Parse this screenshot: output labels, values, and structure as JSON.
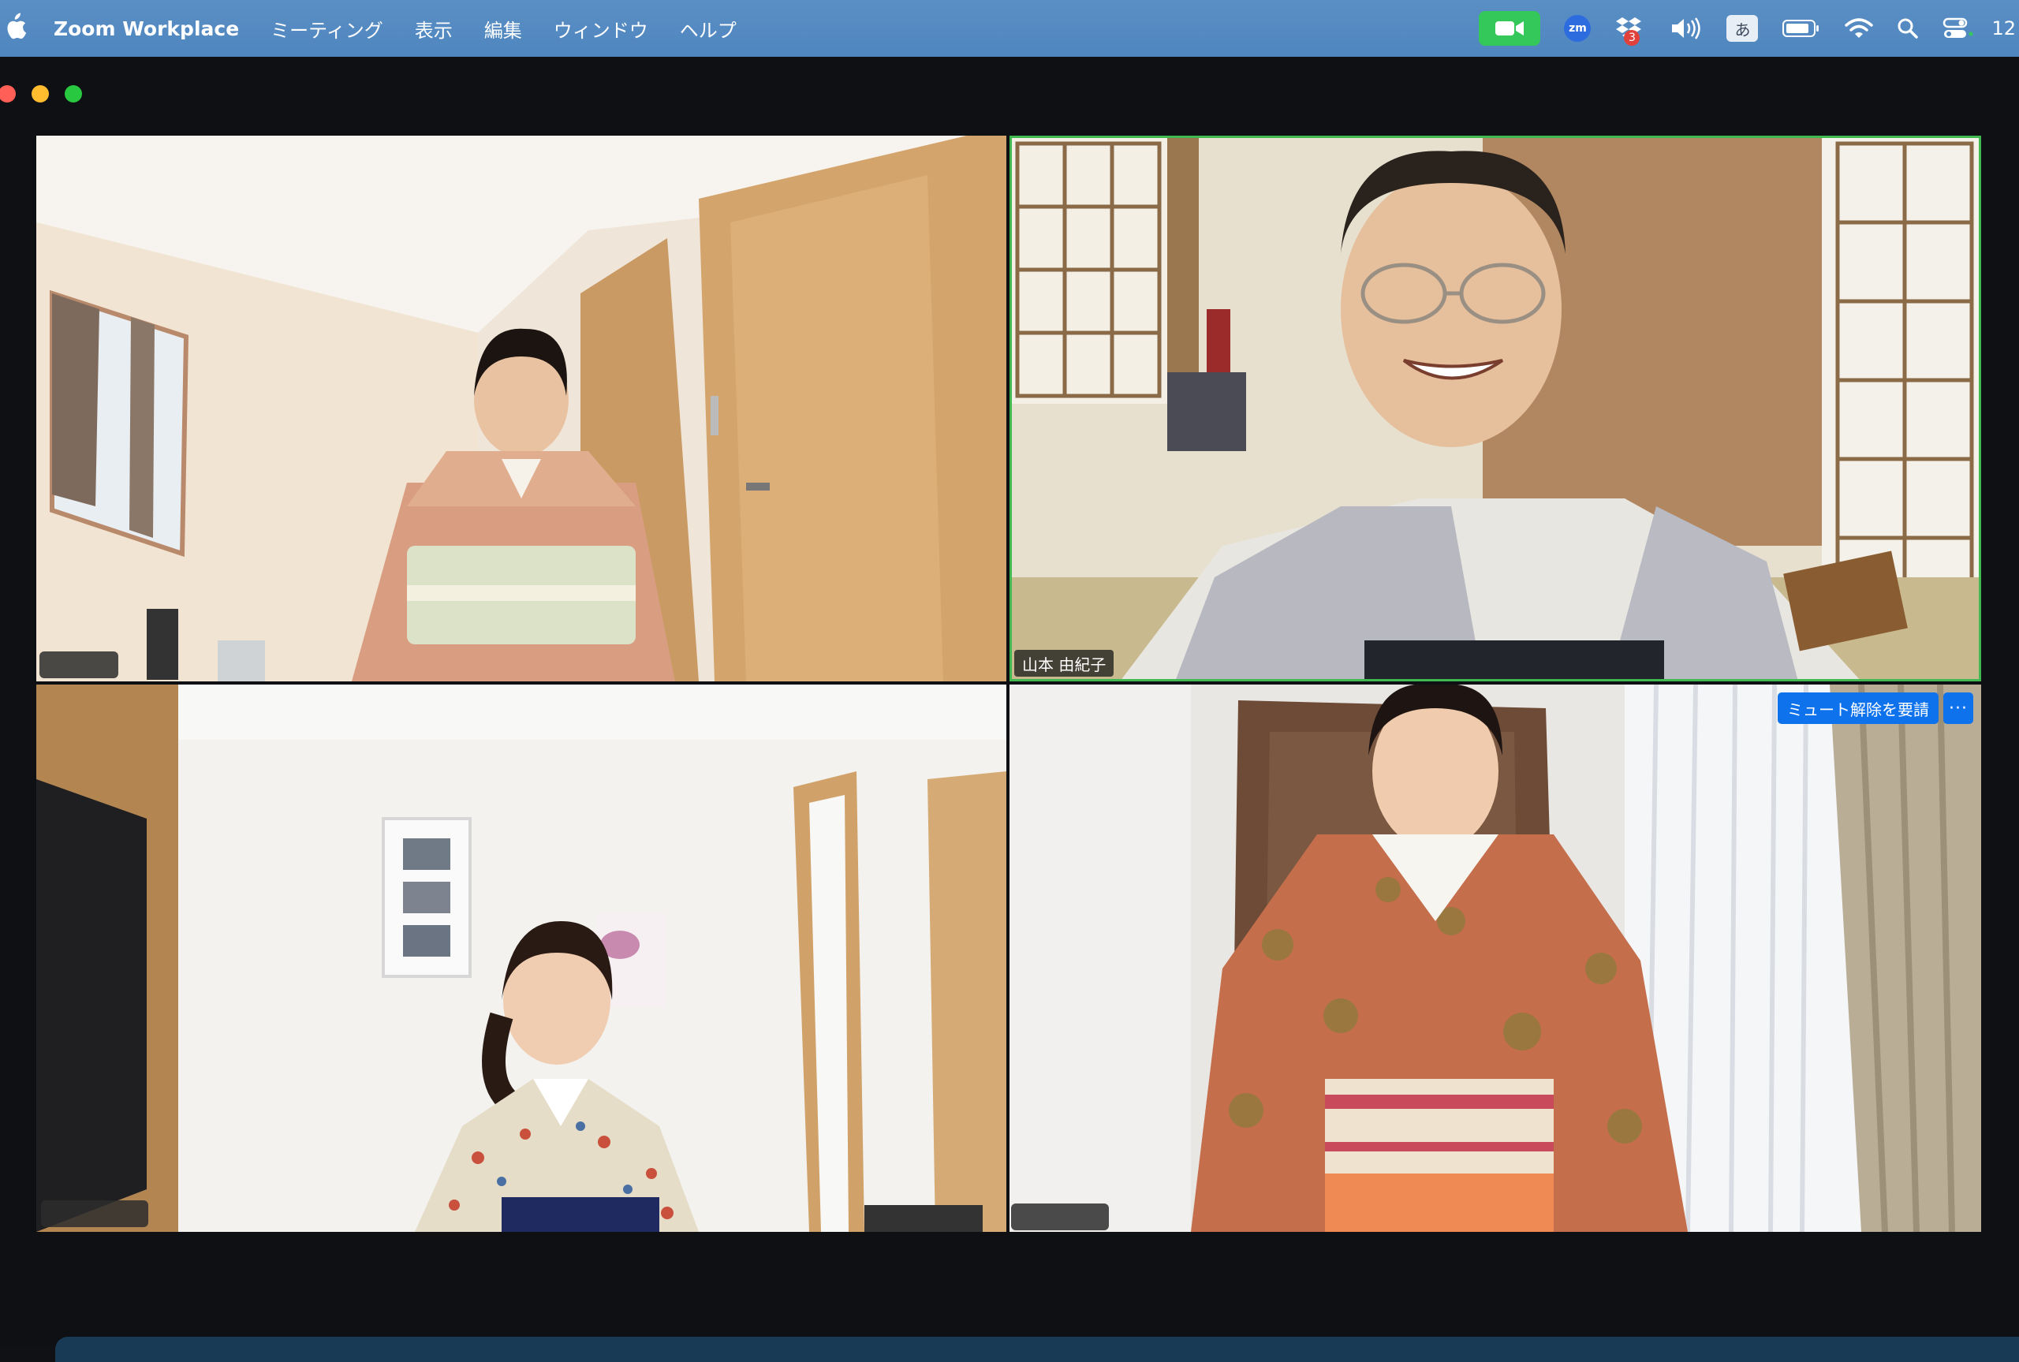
{
  "menubar": {
    "app_name": "Zoom Workplace",
    "menus": [
      "ミーティング",
      "表示",
      "編集",
      "ウィンドウ",
      "ヘルプ"
    ],
    "status_icons": [
      "zoom-video-icon",
      "zoom-app-icon",
      "dropbox-icon",
      "volume-icon",
      "input-method-icon",
      "battery-icon",
      "wifi-icon",
      "spotlight-search-icon",
      "control-center-icon"
    ],
    "zm_label": "zm",
    "dropbox_badge": "3",
    "ime_label": "あ",
    "clock": "12"
  },
  "meeting": {
    "tiles": [
      {
        "name": ""
      },
      {
        "name": "山本 由紀子",
        "active_speaker": true
      },
      {
        "name": ""
      },
      {
        "name": "",
        "ask_unmute_label": "ミュート解除を要請",
        "more_label": "···"
      }
    ]
  },
  "colors": {
    "menubar": "#4f86bf",
    "active_speaker_border": "#3fb950",
    "zoom_blue": "#0e72ed",
    "zoom_green": "#34c759"
  }
}
